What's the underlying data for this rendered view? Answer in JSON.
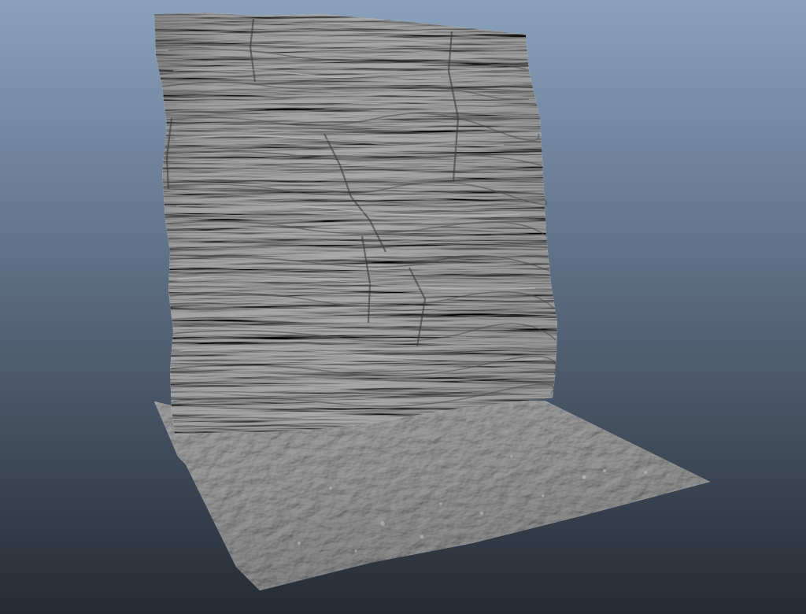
{
  "viewport": {
    "background_top": "#8aa2bd",
    "background_bottom": "#262b33"
  },
  "scene": {
    "objects": [
      {
        "name": "rock-cliff-wall",
        "material": "default-grey",
        "color": "#a9a9a9"
      },
      {
        "name": "ground-plane",
        "material": "default-grey",
        "color": "#999999"
      }
    ]
  }
}
